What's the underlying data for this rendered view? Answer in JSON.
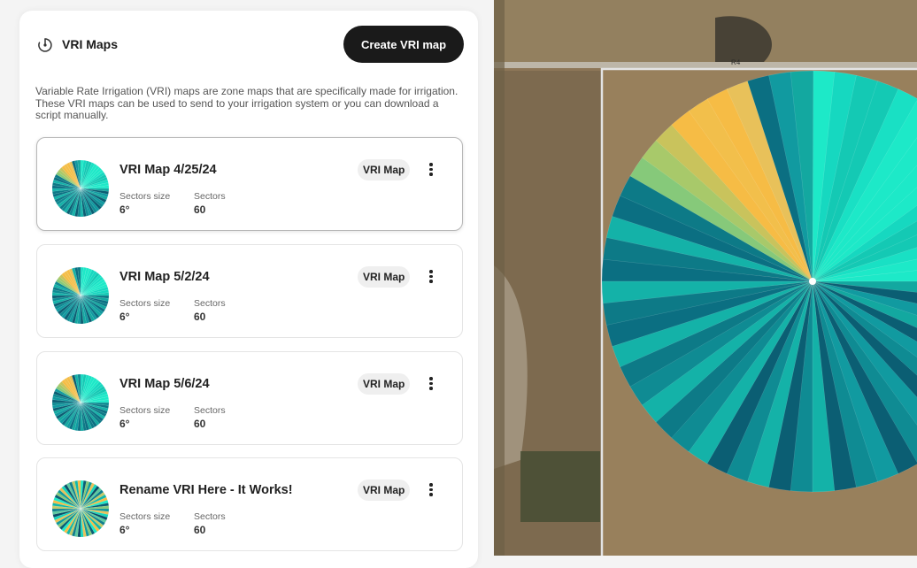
{
  "panel": {
    "title": "VRI Maps",
    "create_button_label": "Create VRI map",
    "description": "Variable Rate Irrigation (VRI) maps are zone maps that are specifically made for irrigation. These VRI maps can be used to send to your irrigation system or you can download a script manually."
  },
  "cards": [
    {
      "title": "VRI Map 4/25/24",
      "badge": "VRI Map",
      "sector_size_label": "Sectors size",
      "sector_size": "6°",
      "sectors_label": "Sectors",
      "sectors": "60"
    },
    {
      "title": "VRI Map 5/2/24",
      "badge": "VRI Map",
      "sector_size_label": "Sectors size",
      "sector_size": "6°",
      "sectors_label": "Sectors",
      "sectors": "60"
    },
    {
      "title": "VRI Map 5/6/24",
      "badge": "VRI Map",
      "sector_size_label": "Sectors size",
      "sector_size": "6°",
      "sectors_label": "Sectors",
      "sectors": "60"
    },
    {
      "title": "Rename VRI Here - It Works!",
      "badge": "VRI Map",
      "sector_size_label": "Sectors size",
      "sector_size": "6°",
      "sectors_label": "Sectors",
      "sectors": "60"
    }
  ],
  "map": {
    "road_label": "R4"
  },
  "icons": {
    "header": "irrigation-pivot-icon",
    "card_menu": "kebab-menu-icon"
  },
  "colors": {
    "button_bg": "#1a1a1a",
    "aqua": "#1de9c8",
    "teal": "#13a8a0",
    "deep_teal": "#0b5e73",
    "yellow": "#f6bc45",
    "green": "#86c97a"
  }
}
